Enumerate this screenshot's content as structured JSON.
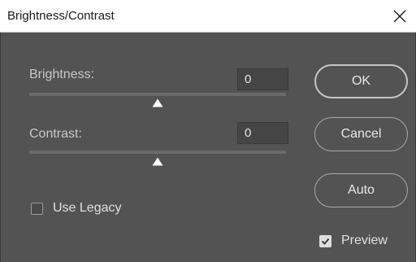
{
  "window": {
    "title": "Brightness/Contrast"
  },
  "brightness": {
    "label": "Brightness:",
    "value": "0",
    "slider_position": 0.5
  },
  "contrast": {
    "label": "Contrast:",
    "value": "0",
    "slider_position": 0.5
  },
  "buttons": {
    "ok": "OK",
    "cancel": "Cancel",
    "auto": "Auto"
  },
  "options": {
    "use_legacy": {
      "label": "Use Legacy",
      "checked": false
    },
    "preview": {
      "label": "Preview",
      "checked": true
    }
  },
  "icons": {
    "close": "close-icon",
    "slider_thumb": "triangle-thumb-icon",
    "checkmark": "checkmark-icon"
  },
  "colors": {
    "dialog_bg": "#535353",
    "title_bg": "#ffffff",
    "field_bg": "#454545",
    "text": "#c8c8c8"
  }
}
